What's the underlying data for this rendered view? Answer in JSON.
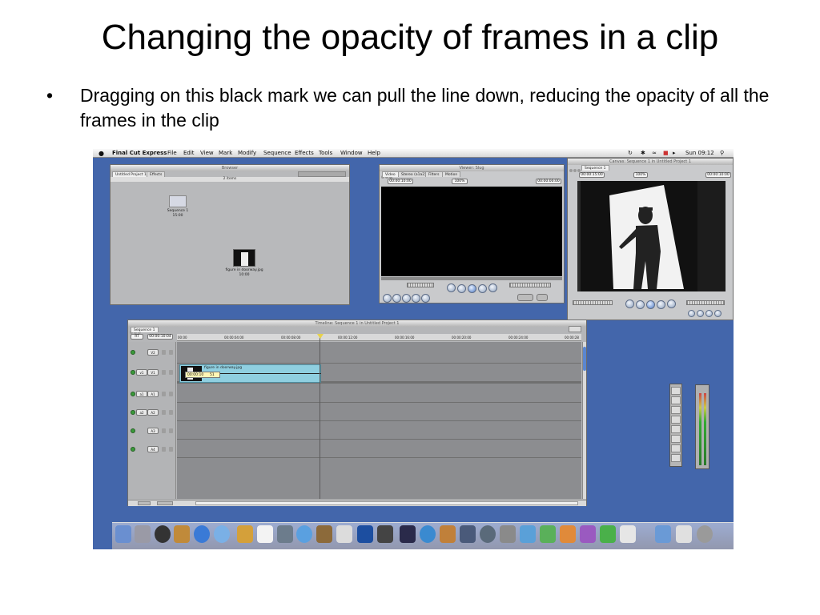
{
  "slide": {
    "title": "Changing the opacity of frames in a clip",
    "bullet_marker": "•",
    "bullet": "Dragging on this black mark we can pull the line down, reducing the opacity of all the frames in the clip"
  },
  "menubar": {
    "apple": "",
    "app_name": "Final Cut Express",
    "items": [
      "File",
      "Edit",
      "View",
      "Mark",
      "Modify",
      "Sequence",
      "Effects",
      "Tools",
      "Window",
      "Help"
    ],
    "clock": "Sun 09:12"
  },
  "browser": {
    "title": "Browser",
    "tabs": [
      "Untitled Project 1",
      "Effects"
    ],
    "count": "2 items",
    "items": [
      {
        "name": "Sequence 1",
        "duration": "15:00"
      },
      {
        "name": "figure in doorway.jpg",
        "duration": "10:00"
      }
    ]
  },
  "viewer": {
    "title": "Viewer: Slug",
    "tabs": [
      "Video",
      "Stereo (a1a2)",
      "Filters",
      "Motion"
    ],
    "timecode_left": "00:00:10:00",
    "zoom": "100%",
    "timecode_right": "00:00:00:00"
  },
  "canvas": {
    "title": "Canvas: Sequence 1 in Untitled Project 1",
    "tab": "Sequence 1",
    "timecode_left": "00:00:15:00",
    "zoom": "100%",
    "timecode_right": "00:00:10:00"
  },
  "timeline": {
    "title": "Timeline: Sequence 1 in Untitled Project 1",
    "tab": "Sequence 1",
    "rt": "RT",
    "playhead_tc": "00:00:10:04",
    "ruler": [
      "00:00",
      "00:00:04:00",
      "00:00:08:00",
      "00:00:12:00",
      "00:00:16:00",
      "00:00:20:00",
      "00:00:24:00",
      "00:00:28"
    ],
    "video_tracks": [
      {
        "src": "",
        "dst": "V2"
      },
      {
        "src": "v1",
        "dst": "V1"
      }
    ],
    "audio_tracks": [
      {
        "src": "a1",
        "dst": "A1"
      },
      {
        "src": "a2",
        "dst": "A2"
      },
      {
        "src": "",
        "dst": "A3"
      },
      {
        "src": "",
        "dst": "A4"
      }
    ],
    "clip": {
      "name": "figure in doorway.jpg",
      "tooltip_tc": "00:00:10",
      "tooltip_val": "51"
    }
  },
  "colors": {
    "desktop": "#4366ab",
    "clip": "#8fcfe0",
    "play_accent": "#4d79c4"
  }
}
